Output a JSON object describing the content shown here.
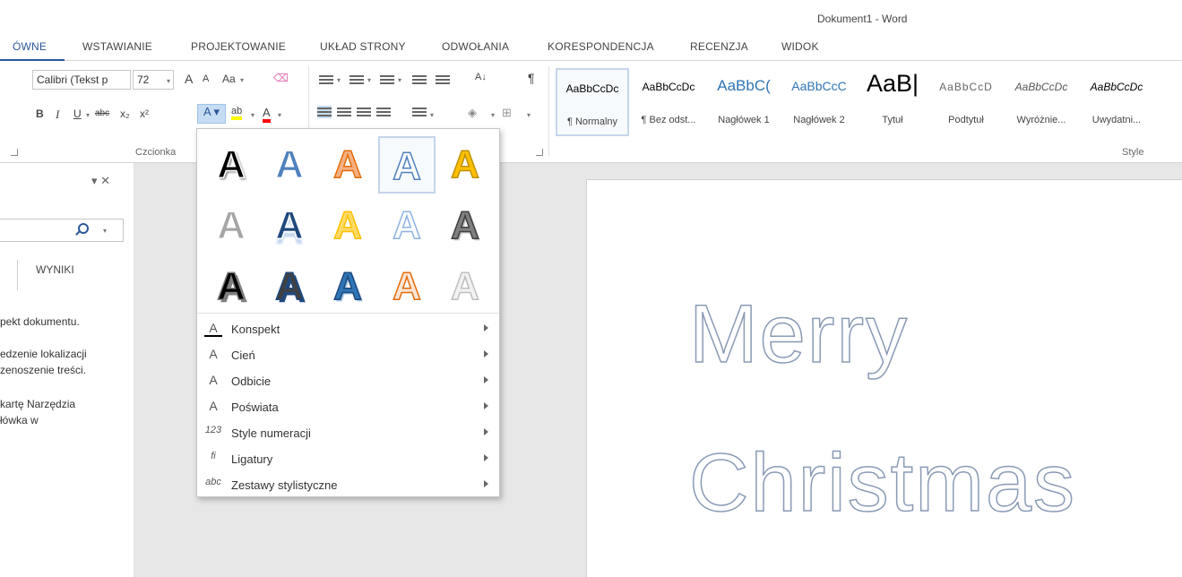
{
  "window": {
    "title": "Dokument1 - Word"
  },
  "tabs": [
    {
      "label": "ÓWNE"
    },
    {
      "label": "WSTAWIANIE"
    },
    {
      "label": "PROJEKTOWANIE"
    },
    {
      "label": "UKŁAD STRONY"
    },
    {
      "label": "ODWOŁANIA"
    },
    {
      "label": "KORESPONDENCJA"
    },
    {
      "label": "RECENZJA"
    },
    {
      "label": "WIDOK"
    }
  ],
  "ribbon": {
    "font_name": "Calibri (Tekst p",
    "font_size": "72",
    "grow_label": "A",
    "shrink_label": "A",
    "change_case_label": "Aa",
    "bold_label": "B",
    "italic_label": "I",
    "underline_label": "U",
    "strike_label": "abc",
    "subscript_label": "x₂",
    "superscript_label": "x²",
    "text_effects_label": "A",
    "highlight_label": "ab",
    "font_color_label": "A",
    "sort_label": "A↓",
    "pilcrow_label": "¶",
    "font_group_label": "Czcionka",
    "styles_group_label": "Style",
    "highlight_color": "#ffff00",
    "font_color": "#ff0000"
  },
  "styles": [
    {
      "sample": "AaBbCcDc",
      "name": "¶ Normalny"
    },
    {
      "sample": "AaBbCcDc",
      "name": "¶ Bez odst..."
    },
    {
      "sample": "AaBbC(",
      "name": "Nagłówek 1"
    },
    {
      "sample": "AaBbCcC",
      "name": "Nagłówek 2"
    },
    {
      "sample": "AaB|",
      "name": "Tytuł"
    },
    {
      "sample": "AaBbCcD",
      "name": "Podtytuł"
    },
    {
      "sample": "AaBbCcDc",
      "name": "Wyróżnie..."
    },
    {
      "sample": "AaBbCcDc",
      "name": "Uwydatni..."
    }
  ],
  "nav_pane": {
    "close_symbol": "▾ ✕",
    "search_dd": "▾",
    "results_tab": "WYNIKI",
    "lines": [
      "pekt dokumentu.",
      "edzenie lokalizacji",
      "zenoszenie treści.",
      "kartę Narzędzia",
      "łówka w"
    ]
  },
  "text_effects": {
    "glyph": "A",
    "rows": [
      [
        {
          "fill": "#000000",
          "stroke": "#ffffff",
          "shadow": "2px 2px 2px #888"
        },
        {
          "fill": "#4f81bd",
          "stroke": "#ffffff",
          "shadow": "none"
        },
        {
          "fill": "#f4b183",
          "stroke": "#e46c0a",
          "shadow": "none"
        },
        {
          "fill": "#ffffff",
          "stroke": "#4f81bd",
          "shadow": "none"
        },
        {
          "fill": "#ffc000",
          "stroke": "#bf8f00",
          "shadow": "none"
        }
      ],
      [
        {
          "fill": "#a5a5a5",
          "stroke": "#ffffff",
          "shadow": "none"
        },
        {
          "fill": "#1f497d",
          "stroke": "#ffffff",
          "shadow": "0px 6px 2px #c6d9f1"
        },
        {
          "fill": "#ffd966",
          "stroke": "#ffc000",
          "shadow": "none"
        },
        {
          "fill": "#ffffff",
          "stroke": "#8db3e2",
          "shadow": "none"
        },
        {
          "fill": "#7f7f7f",
          "stroke": "#404040",
          "shadow": "2px 2px 1px #bfbfbf"
        }
      ],
      [
        {
          "fill": "#000000",
          "stroke": "#7f7f7f",
          "shadow": "3px 3px 0px #7f7f7f"
        },
        {
          "fill": "#404040",
          "stroke": "#1f497d",
          "shadow": "3px 3px 0px #1f497d"
        },
        {
          "fill": "#2e75b6",
          "stroke": "#1f497d",
          "shadow": "2px 2px 1px #9dc3e6"
        },
        {
          "fill": "#fbe5d6",
          "stroke": "#e46c0a",
          "shadow": "none"
        },
        {
          "fill": "#f2f2f2",
          "stroke": "#bfbfbf",
          "shadow": "none"
        }
      ]
    ],
    "menu": [
      {
        "icon": "A",
        "label": "Konspekt",
        "name": "outline"
      },
      {
        "icon": "A",
        "label": "Cień",
        "name": "shadow"
      },
      {
        "icon": "A",
        "label": "Odbicie",
        "name": "reflection"
      },
      {
        "icon": "A",
        "label": "Poświata",
        "name": "glow"
      },
      {
        "icon": "123",
        "label": "Style numeracji",
        "name": "number-styles"
      },
      {
        "icon": "fi",
        "label": "Ligatury",
        "name": "ligatures"
      },
      {
        "icon": "abc",
        "label": "Zestawy stylistyczne",
        "name": "stylistic-sets"
      }
    ]
  },
  "document": {
    "line1": "Merry",
    "line2": "Christmas",
    "text_outline_color": "#8a9ab5"
  }
}
